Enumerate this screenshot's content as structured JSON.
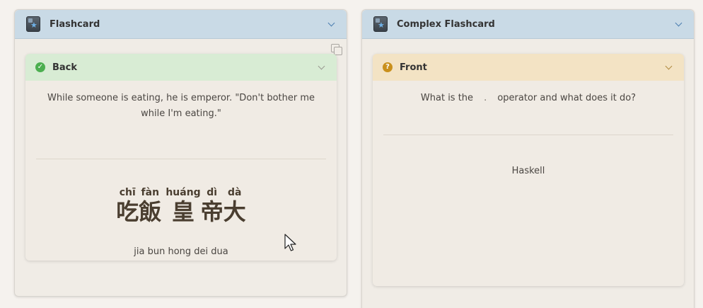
{
  "left_panel": {
    "title": "Flashcard",
    "card": {
      "label": "Back",
      "sentence": "While someone is eating, he is emperor. \"Don't bother me while I'm eating.\"",
      "words": [
        {
          "pinyin": "chī",
          "hanzi": "吃"
        },
        {
          "pinyin": "fàn",
          "hanzi": "飯"
        },
        {
          "pinyin": "huáng",
          "hanzi": "皇"
        },
        {
          "pinyin": "dì",
          "hanzi": "帝"
        },
        {
          "pinyin": "dà",
          "hanzi": "大"
        }
      ],
      "romanization": "jia bun hong dei dua"
    }
  },
  "right_panel": {
    "title": "Complex Flashcard",
    "card": {
      "label": "Front",
      "question_before": "What is the",
      "question_code": ".",
      "question_after": "operator and what does it do?",
      "answer": "Haskell"
    }
  },
  "colors": {
    "panel_header": "#c9dae6",
    "back_header": "#d8ecd4",
    "front_header": "#f3e3c4",
    "success": "#4caf50",
    "warning": "#c9901c"
  }
}
